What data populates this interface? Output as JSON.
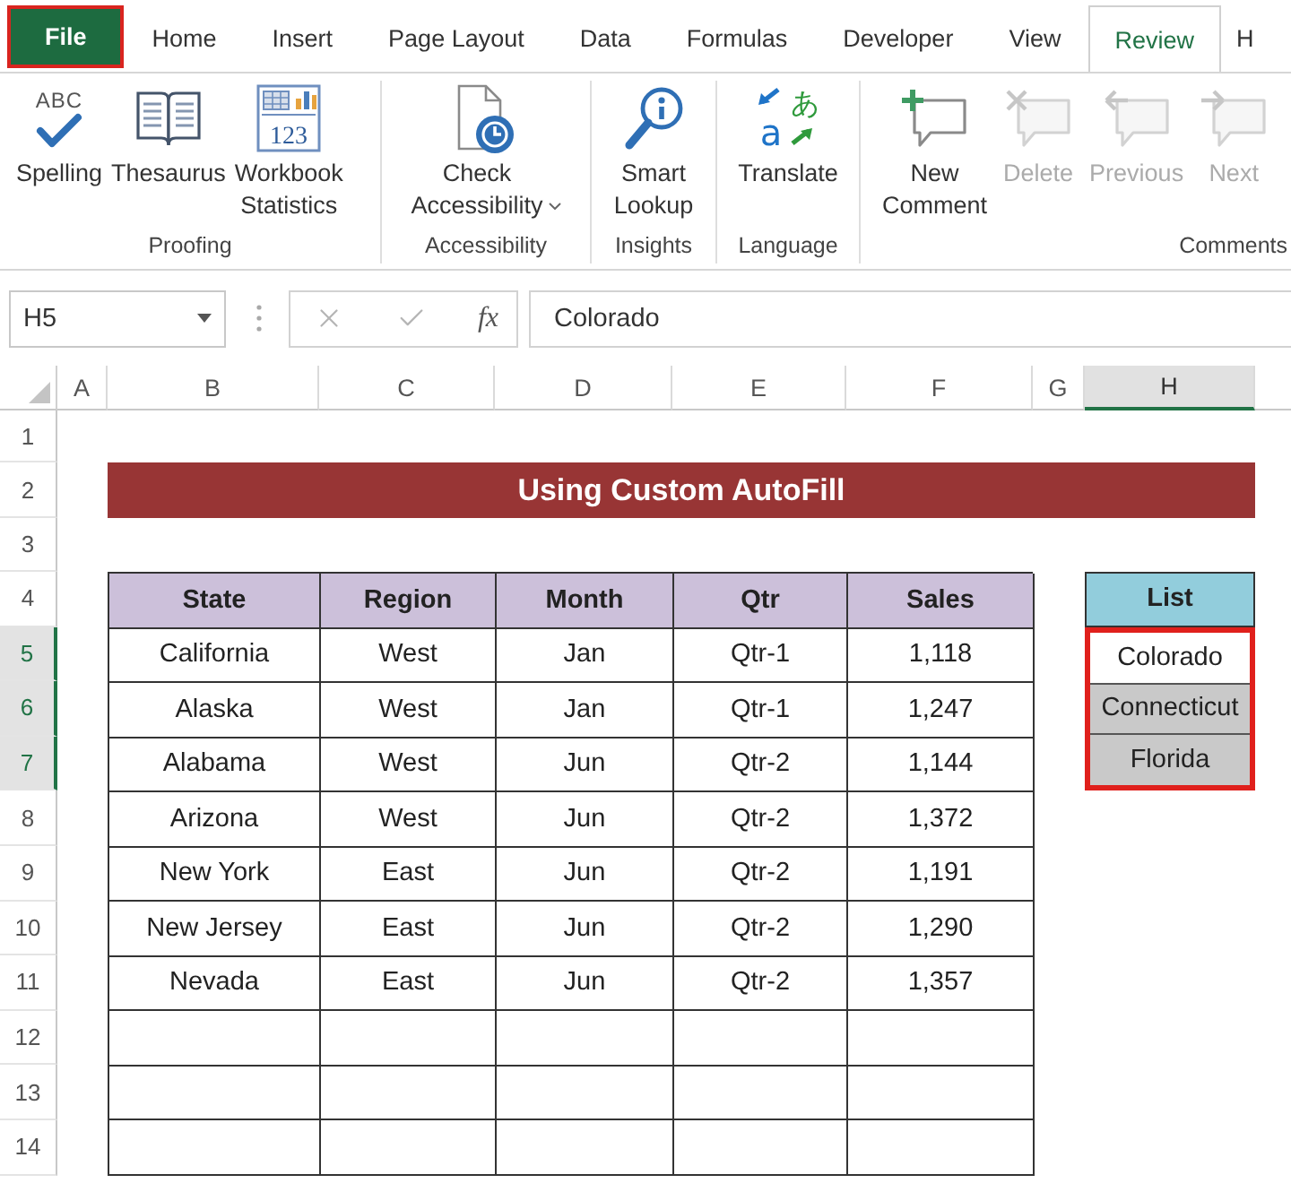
{
  "ribbon_tabs": [
    {
      "label": "File",
      "kind": "file",
      "selected": false,
      "highlighted": true
    },
    {
      "label": "Home",
      "kind": "tab",
      "selected": false,
      "highlighted": false
    },
    {
      "label": "Insert",
      "kind": "tab",
      "selected": false,
      "highlighted": false
    },
    {
      "label": "Page Layout",
      "kind": "tab",
      "selected": false,
      "highlighted": false
    },
    {
      "label": "Data",
      "kind": "tab",
      "selected": false,
      "highlighted": false
    },
    {
      "label": "Formulas",
      "kind": "tab",
      "selected": false,
      "highlighted": false
    },
    {
      "label": "Developer",
      "kind": "tab",
      "selected": false,
      "highlighted": false
    },
    {
      "label": "View",
      "kind": "tab",
      "selected": false,
      "highlighted": false
    },
    {
      "label": "Review",
      "kind": "tab",
      "selected": true,
      "highlighted": false
    },
    {
      "label": "H",
      "kind": "tab",
      "selected": false,
      "highlighted": false
    }
  ],
  "ribbon_groups": [
    {
      "label": "Proofing",
      "commands": [
        {
          "label": "Spelling",
          "kind": "spelling",
          "icon_text": [
            "ABC"
          ],
          "disabled": false,
          "dropdown": false
        },
        {
          "label": "Thesaurus",
          "kind": "thesaurus",
          "disabled": false,
          "dropdown": false
        },
        {
          "label": "Workbook Statistics",
          "kind": "statistics",
          "icon_text": [
            "123"
          ],
          "disabled": false,
          "dropdown": false
        }
      ]
    },
    {
      "label": "Accessibility",
      "commands": [
        {
          "label": "Check Accessibility",
          "kind": "accessibility",
          "disabled": false,
          "dropdown": true
        }
      ]
    },
    {
      "label": "Insights",
      "commands": [
        {
          "label": "Smart Lookup",
          "kind": "lookup",
          "disabled": false,
          "dropdown": false
        }
      ]
    },
    {
      "label": "Language",
      "commands": [
        {
          "label": "Translate",
          "kind": "translate",
          "icon_text": [
            "a",
            "あ"
          ],
          "disabled": false,
          "dropdown": false
        }
      ]
    },
    {
      "label": "Comments",
      "commands": [
        {
          "label": "New Comment",
          "kind": "new_comment",
          "disabled": false,
          "dropdown": false
        },
        {
          "label": "Delete",
          "kind": "delete_comment",
          "disabled": true,
          "dropdown": false
        },
        {
          "label": "Previous",
          "kind": "previous_comment",
          "disabled": true,
          "dropdown": false
        },
        {
          "label": "Next",
          "kind": "next_comment",
          "disabled": true,
          "dropdown": false
        }
      ]
    }
  ],
  "formula_bar": {
    "name_box": "H5",
    "function_label": "fx",
    "value": "Colorado"
  },
  "column_headers": [
    {
      "label": "A",
      "selected": false
    },
    {
      "label": "B",
      "selected": false
    },
    {
      "label": "C",
      "selected": false
    },
    {
      "label": "D",
      "selected": false
    },
    {
      "label": "E",
      "selected": false
    },
    {
      "label": "F",
      "selected": false
    },
    {
      "label": "G",
      "selected": false
    },
    {
      "label": "H",
      "selected": true
    }
  ],
  "row_headers": [
    {
      "label": "1",
      "selected": false
    },
    {
      "label": "2",
      "selected": false
    },
    {
      "label": "3",
      "selected": false
    },
    {
      "label": "4",
      "selected": false
    },
    {
      "label": "5",
      "selected": true
    },
    {
      "label": "6",
      "selected": true
    },
    {
      "label": "7",
      "selected": true
    },
    {
      "label": "8",
      "selected": false
    },
    {
      "label": "9",
      "selected": false
    },
    {
      "label": "10",
      "selected": false
    },
    {
      "label": "11",
      "selected": false
    },
    {
      "label": "12",
      "selected": false
    },
    {
      "label": "13",
      "selected": false
    },
    {
      "label": "14",
      "selected": false
    }
  ],
  "title": "Using Custom AutoFill",
  "table": {
    "columns": [
      "State",
      "Region",
      "Month",
      "Qtr",
      "Sales"
    ],
    "rows": [
      [
        "California",
        "West",
        "Jan",
        "Qtr-1",
        "1,118"
      ],
      [
        "Alaska",
        "West",
        "Jan",
        "Qtr-1",
        "1,247"
      ],
      [
        "Alabama",
        "West",
        "Jun",
        "Qtr-2",
        "1,144"
      ],
      [
        "Arizona",
        "West",
        "Jun",
        "Qtr-2",
        "1,372"
      ],
      [
        "New York",
        "East",
        "Jun",
        "Qtr-2",
        "1,191"
      ],
      [
        "New Jersey",
        "East",
        "Jun",
        "Qtr-2",
        "1,290"
      ],
      [
        "Nevada",
        "East",
        "Jun",
        "Qtr-2",
        "1,357"
      ]
    ]
  },
  "list": {
    "header": "List",
    "highlighted": true,
    "items": [
      {
        "value": "Colorado",
        "active": true
      },
      {
        "value": "Connecticut",
        "active": false
      },
      {
        "value": "Florida",
        "active": false
      }
    ]
  }
}
